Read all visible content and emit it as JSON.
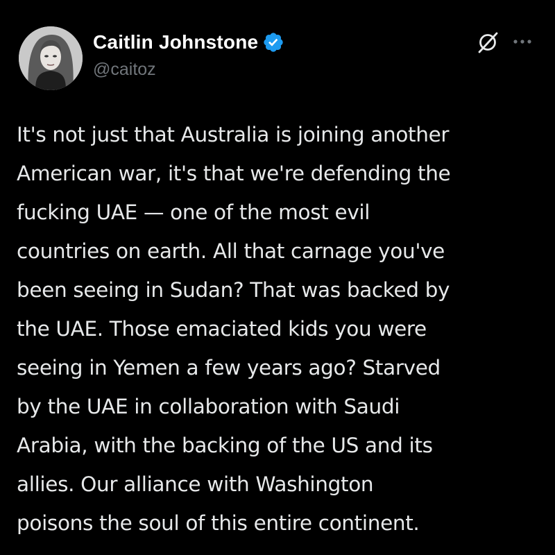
{
  "author": {
    "display_name": "Caitlin Johnstone",
    "handle": "@caitoz",
    "verified": true,
    "avatar_icon": "profile-photo"
  },
  "actions": {
    "grok_icon": "grok-icon",
    "more_icon": "more-horizontal-icon"
  },
  "tweet": {
    "lines": [
      "It's not just that Australia is joining another",
      "American war, it's that we're defending the",
      "fucking UAE — one of the most evil",
      "countries on earth. All that carnage you've",
      "been seeing in Sudan? That was backed by",
      "the UAE. Those emaciated kids you were",
      "seeing in Yemen a few years ago? Starved",
      "by the UAE in collaboration with Saudi",
      "Arabia, with the backing of the US and its",
      "allies. Our alliance with Washington",
      "poisons the soul of this entire continent."
    ]
  },
  "colors": {
    "background": "#000000",
    "text": "#e7e9ea",
    "secondary_text": "#71767b",
    "verified_badge": "#1d9bf0"
  }
}
